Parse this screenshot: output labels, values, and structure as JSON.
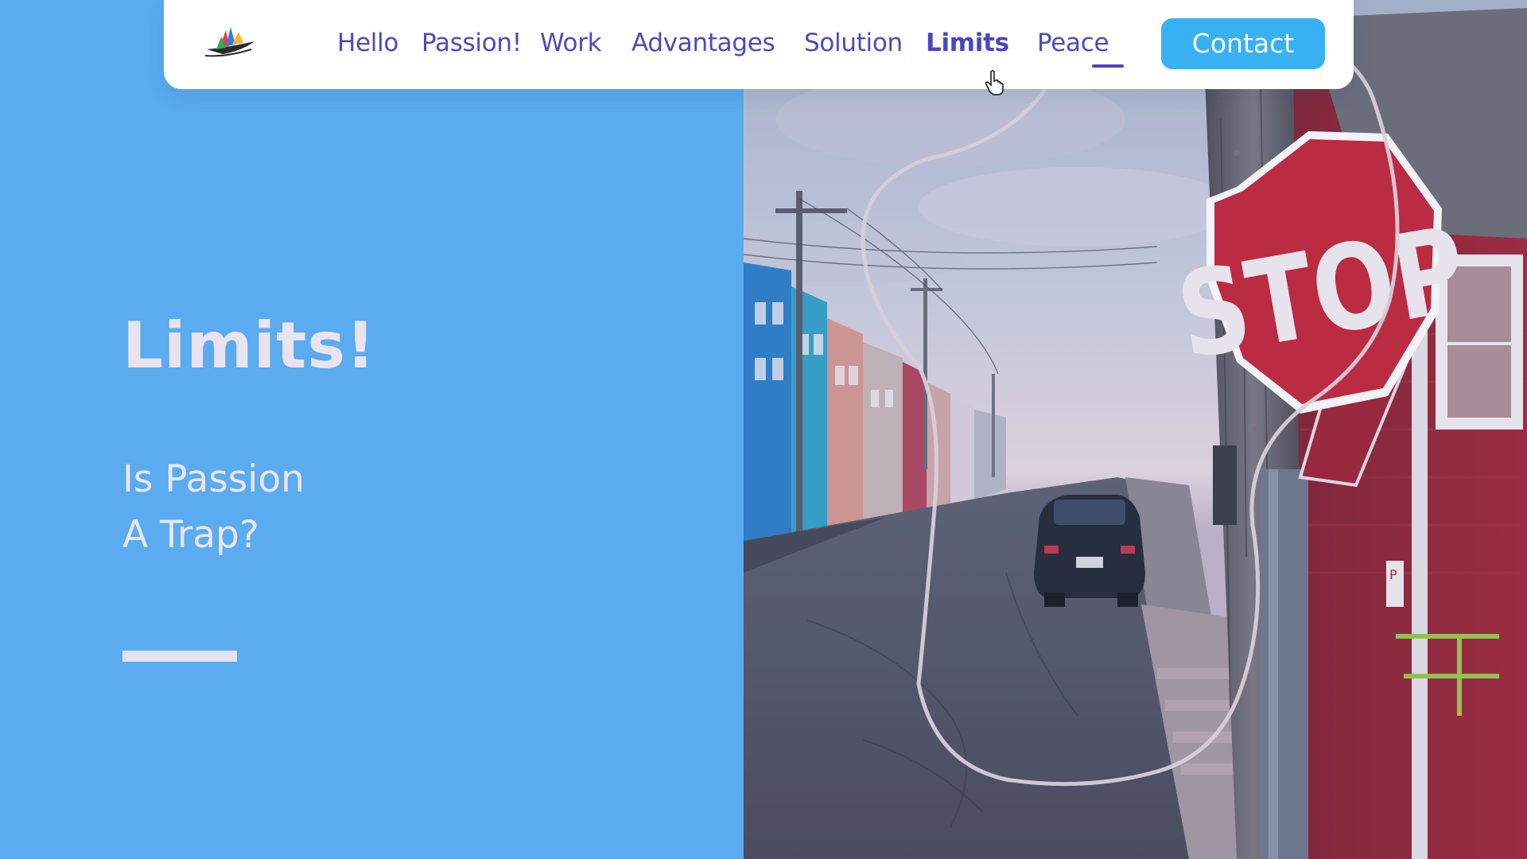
{
  "nav": {
    "items": [
      {
        "label": "Hello"
      },
      {
        "label": "Passion!"
      },
      {
        "label": "Work"
      },
      {
        "label": "Advantages"
      },
      {
        "label": "Solution"
      },
      {
        "label": "Limits"
      },
      {
        "label": "Peace"
      }
    ],
    "active": "Limits",
    "contact_label": "Contact"
  },
  "hero": {
    "title": "Limits!",
    "subtitle_line1": "Is Passion",
    "subtitle_line2": "A Trap?"
  },
  "photo": {
    "sign_text": "STOP"
  },
  "icons": {
    "logo": "paper-boat-logo-icon",
    "cursor": "hand-pointer-icon"
  },
  "colors": {
    "panel_blue": "#5aabef",
    "nav_text": "#4a4bbf",
    "contact_button": "#37b1f2",
    "hero_text": "#e9e3ef",
    "stop_red": "#c4273a"
  }
}
